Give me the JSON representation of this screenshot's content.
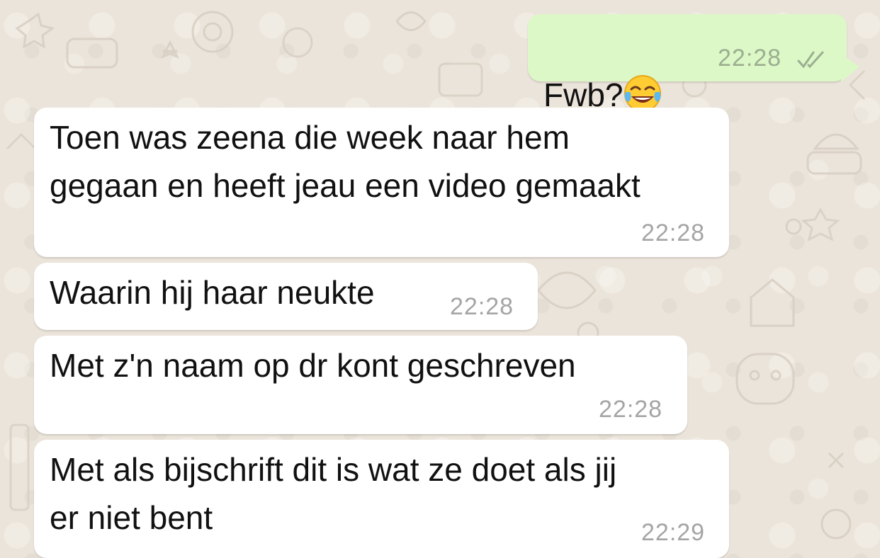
{
  "chat": {
    "messages": [
      {
        "direction": "outgoing",
        "text": "Fwb?",
        "emoji": "face-with-tears-of-joy-icon",
        "time": "22:28",
        "status": "double-check-icon"
      },
      {
        "direction": "incoming",
        "text": "Toen was zeena die week naar hem\ngegaan en heeft jeau een video gemaakt",
        "time": "22:28"
      },
      {
        "direction": "incoming",
        "text": "Waarin hij haar neukte",
        "time": "22:28"
      },
      {
        "direction": "incoming",
        "text": "Met z'n naam op dr kont geschreven",
        "time": "22:28"
      },
      {
        "direction": "incoming",
        "text": "Met als bijschrift dit is wat ze doet als jij\ner niet bent",
        "time": "22:29"
      }
    ]
  },
  "colors": {
    "background": "#ece5dd",
    "incoming_bubble": "#ffffff",
    "outgoing_bubble": "#dcf8c6",
    "timestamp": "#a5a5a5",
    "read_ticks": "#9cae91"
  }
}
